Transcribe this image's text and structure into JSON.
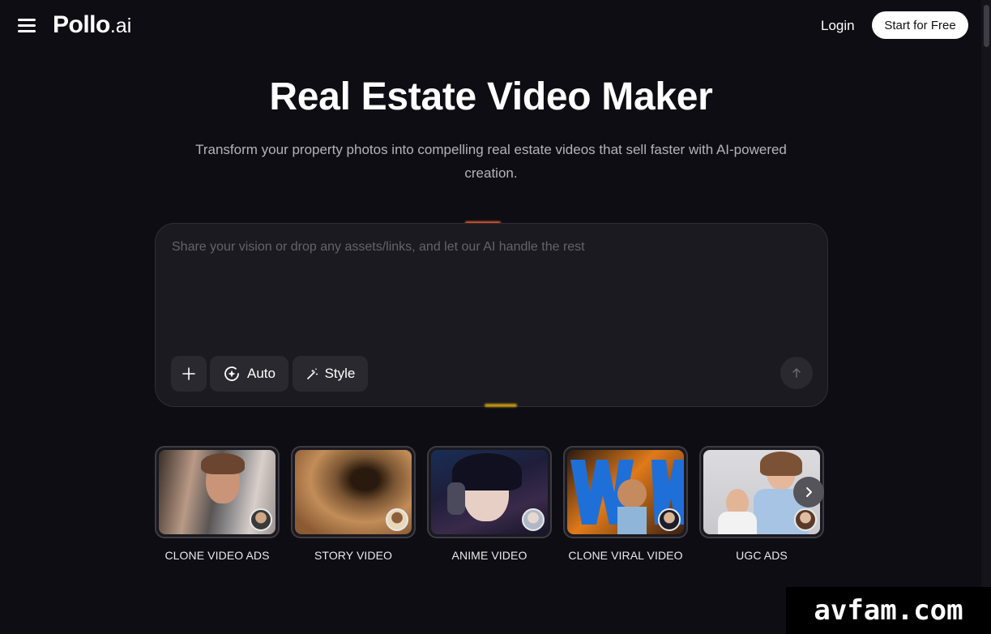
{
  "header": {
    "logo_main": "Pollo",
    "logo_suffix": ".ai",
    "login_label": "Login",
    "cta_label": "Start for Free"
  },
  "hero": {
    "title": "Real Estate Video Maker",
    "subtitle": "Transform your property photos into compelling real estate videos that sell faster with AI-powered creation."
  },
  "prompt": {
    "value": "",
    "placeholder": "Share your vision or drop any assets/links, and let our AI handle the rest",
    "auto_label": "Auto",
    "style_label": "Style"
  },
  "templates": [
    {
      "label": "CLONE VIDEO ADS"
    },
    {
      "label": "STORY VIDEO"
    },
    {
      "label": "ANIME VIDEO"
    },
    {
      "label": "CLONE VIRAL VIDEO"
    },
    {
      "label": "UGC ADS"
    }
  ],
  "watermark": "avfam.com",
  "colors": {
    "background": "#0e0d13",
    "panel": "#1b1a20",
    "button": "#2a2930",
    "accent_orange": "#e25b2d",
    "accent_gold": "#c99a14"
  },
  "icons": [
    "menu-icon",
    "plus-icon",
    "auto-mode-icon",
    "magic-wand-icon",
    "arrow-up-icon",
    "chevron-right-icon"
  ]
}
